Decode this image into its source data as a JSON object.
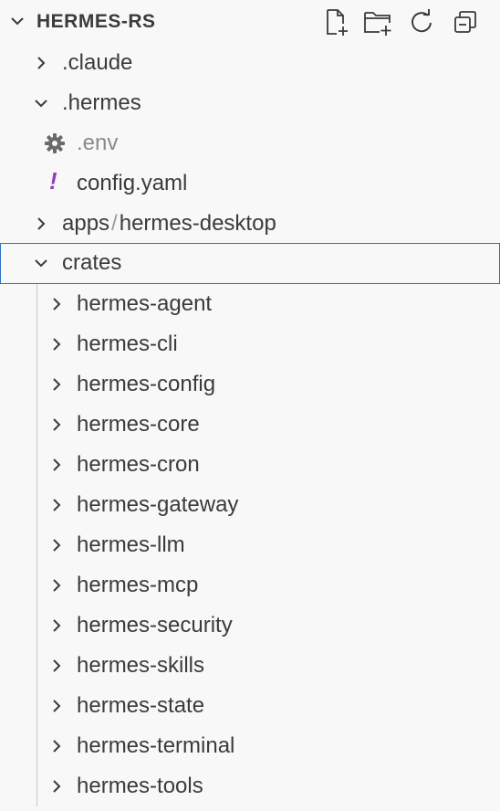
{
  "explorer": {
    "root_title": "HERMES-RS",
    "actions": [
      {
        "name": "new-file",
        "icon": "new-file-icon"
      },
      {
        "name": "new-folder",
        "icon": "new-folder-icon"
      },
      {
        "name": "refresh",
        "icon": "refresh-icon"
      },
      {
        "name": "collapse-all",
        "icon": "collapse-all-icon"
      }
    ],
    "top_items": {
      "claude": ".claude",
      "hermes": ".hermes",
      "env": ".env",
      "config": "config.yaml",
      "apps_part1": "apps",
      "apps_sep": "/",
      "apps_part2": "hermes-desktop",
      "crates": "crates"
    },
    "crates": [
      "hermes-agent",
      "hermes-cli",
      "hermes-config",
      "hermes-core",
      "hermes-cron",
      "hermes-gateway",
      "hermes-llm",
      "hermes-mcp",
      "hermes-security",
      "hermes-skills",
      "hermes-state",
      "hermes-terminal",
      "hermes-tools"
    ],
    "colors": {
      "selection_border": "#2a72c8",
      "yaml_icon": "#8f3fbf",
      "muted_text": "#8a8a8a",
      "background": "#f8f8f8"
    }
  }
}
